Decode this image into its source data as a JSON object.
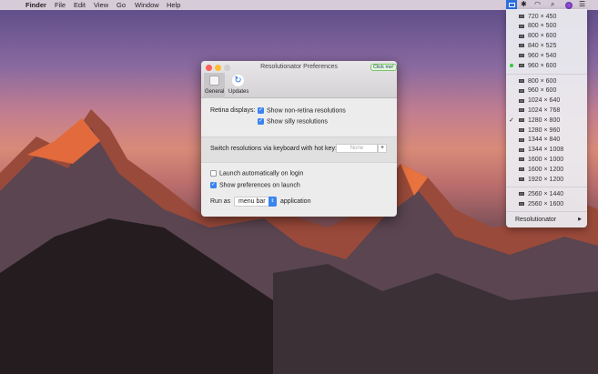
{
  "menubar": {
    "apple": "",
    "items": [
      "Finder",
      "File",
      "Edit",
      "View",
      "Go",
      "Window",
      "Help"
    ]
  },
  "menu": {
    "group1": [
      "720 × 450",
      "800 × 500",
      "800 × 600",
      "840 × 525",
      "960 × 540",
      "960 × 600"
    ],
    "group2": [
      "800 × 600",
      "960 × 600",
      "1024 × 640",
      "1024 × 768",
      "1280 × 800",
      "1280 × 960",
      "1344 × 840",
      "1344 × 1008",
      "1600 × 1000",
      "1600 × 1200",
      "1920 × 1200"
    ],
    "group3": [
      "2560 × 1440",
      "2560 × 1600"
    ],
    "app_item": "Resolutionator",
    "submenu_arrow": "▶",
    "checked": "1280 × 800",
    "active_dot": "960 × 600",
    "check_glyph": "✓"
  },
  "window": {
    "title": "Resolutionator Preferences",
    "badge": "Click me!",
    "tabs": [
      {
        "label": "General"
      },
      {
        "label": "Updates"
      }
    ],
    "retina_label": "Retina displays:",
    "opt_nonretina": "Show non-retina resolutions",
    "opt_silly": "Show silly resolutions",
    "hotkey_label": "Switch resolutions via keyboard with hot key:",
    "hotkey_value": "None",
    "hotkey_add": "+",
    "launch_login": "Launch automatically on login",
    "show_prefs": "Show preferences on launch",
    "run_as": "Run as",
    "run_mode": "menu bar",
    "run_suffix": "application"
  },
  "colors": {
    "accent": "#3a84f0",
    "dot": "#2ecc40"
  }
}
